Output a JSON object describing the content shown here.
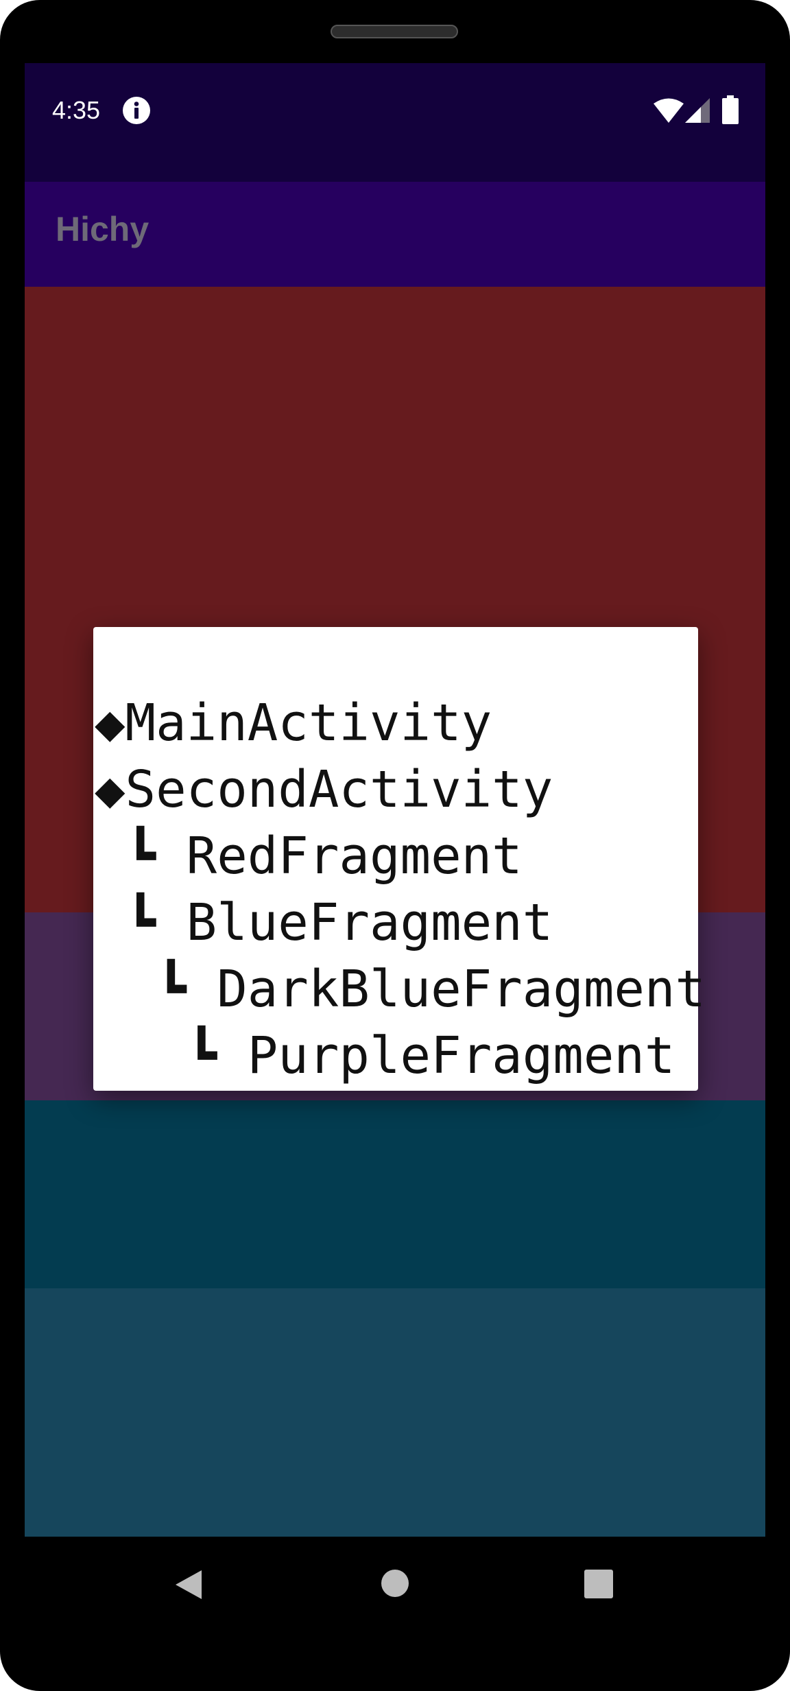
{
  "status_bar": {
    "time": "4:35",
    "icons": [
      "info-icon",
      "wifi-icon",
      "signal-icon",
      "battery-icon"
    ]
  },
  "app_bar": {
    "title": "Hichy"
  },
  "dialog": {
    "lines": [
      "◆MainActivity",
      "◆SecondActivity",
      " ┗ RedFragment",
      " ┗ BlueFragment",
      "  ┗ DarkBlueFragment",
      "   ┗ PurpleFragment"
    ]
  },
  "nav_bar": {
    "icons": [
      "back-icon",
      "home-icon",
      "recents-icon"
    ]
  },
  "colors": {
    "status_bar": "#13013c",
    "app_bar": "#26005f",
    "app_title": "#6e6a78",
    "red_panel": "#661b1e",
    "purple_panel": "#452852",
    "dark_blue_panel": "#033c50",
    "teal_panel": "#16465c",
    "dialog_background": "#ffffff"
  }
}
